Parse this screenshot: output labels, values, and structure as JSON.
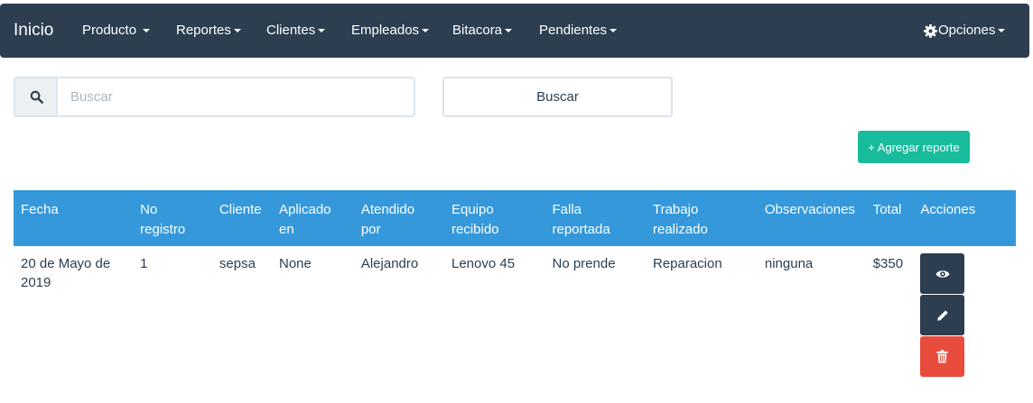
{
  "navbar": {
    "brand": "Inicio",
    "items": [
      {
        "label": "Producto"
      },
      {
        "label": "Reportes"
      },
      {
        "label": "Clientes"
      },
      {
        "label": "Empleados"
      },
      {
        "label": "Bitacora"
      },
      {
        "label": "Pendientes"
      }
    ],
    "options_label": "Opciones"
  },
  "search": {
    "placeholder": "Buscar",
    "value": "",
    "button_label": "Buscar"
  },
  "add_button_label": "+ Agregar reporte",
  "table": {
    "headers": [
      {
        "l1": "Fecha",
        "l2": ""
      },
      {
        "l1": "No",
        "l2": "registro"
      },
      {
        "l1": "Cliente",
        "l2": ""
      },
      {
        "l1": "Aplicado",
        "l2": "en"
      },
      {
        "l1": "Atendido",
        "l2": "por"
      },
      {
        "l1": "Equipo",
        "l2": "recibido"
      },
      {
        "l1": "Falla",
        "l2": "reportada"
      },
      {
        "l1": "Trabajo",
        "l2": "realizado"
      },
      {
        "l1": "Observaciones",
        "l2": ""
      },
      {
        "l1": "Total",
        "l2": ""
      },
      {
        "l1": "Acciones",
        "l2": ""
      }
    ],
    "rows": [
      {
        "fecha_l1": "20 de Mayo de",
        "fecha_l2": "2019",
        "no_registro": "1",
        "cliente": "sepsa",
        "aplicado_en": "None",
        "atendido_por": "Alejandro",
        "equipo_recibido": "Lenovo 45",
        "falla_reportada": "No prende",
        "trabajo_realizado": "Reparacion",
        "observaciones": "ninguna",
        "total": "$350"
      }
    ]
  },
  "icons": {
    "search": "search-icon",
    "options": "gear-icon",
    "view": "eye-icon",
    "edit": "pencil-icon",
    "delete": "trash-icon"
  },
  "colors": {
    "navbar": "#2c3e50",
    "table_header": "#3498db",
    "add_button": "#18bc9c",
    "dark_button": "#2c3e50",
    "danger_button": "#e74c3c"
  }
}
